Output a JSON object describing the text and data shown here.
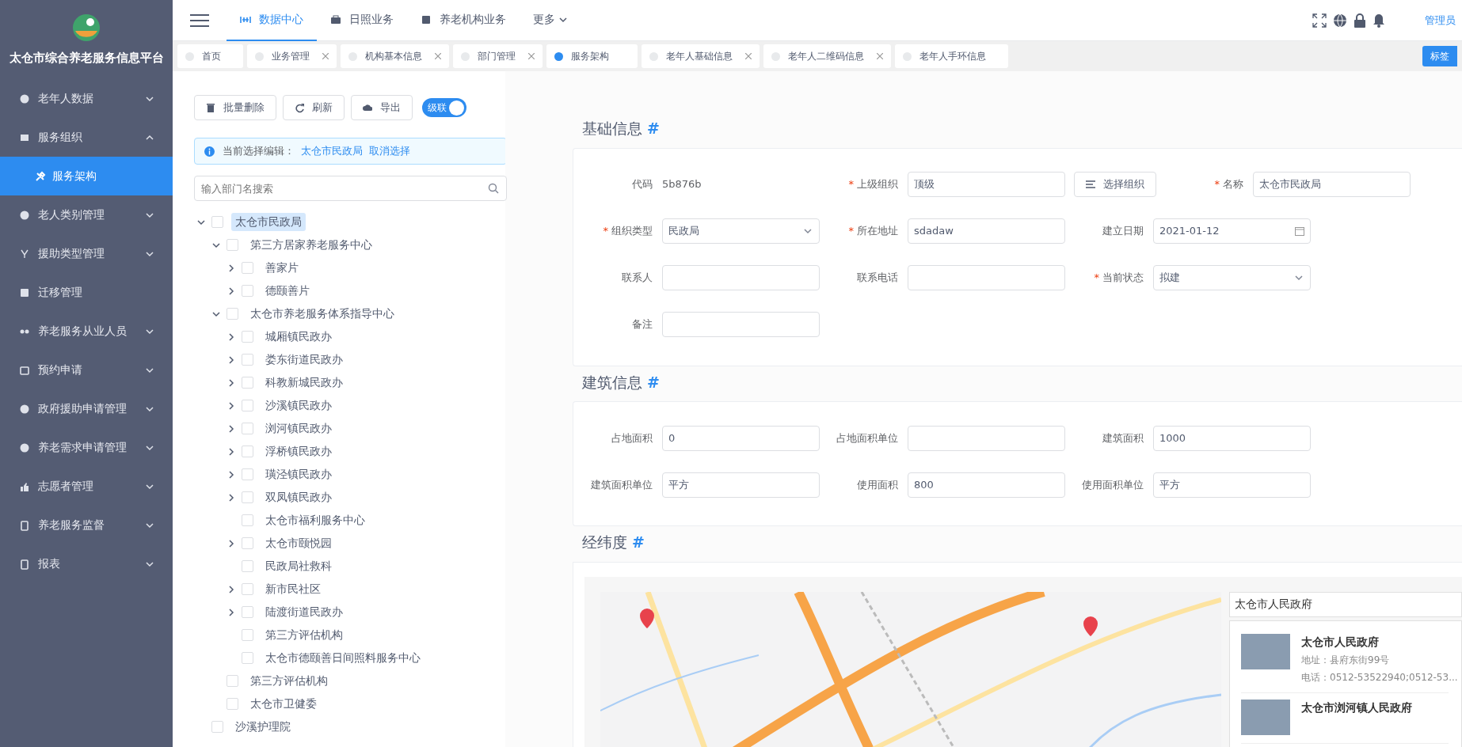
{
  "app": {
    "title": "太仓市综合养老服务信息平台"
  },
  "sidebar": {
    "items": [
      {
        "label": "老年人数据",
        "kind": "group",
        "expanded": false
      },
      {
        "label": "服务组织",
        "kind": "group",
        "expanded": true,
        "children": [
          {
            "label": "服务架构",
            "selected": true
          }
        ]
      },
      {
        "label": "老人类别管理",
        "kind": "group",
        "expanded": false
      },
      {
        "label": "援助类型管理",
        "kind": "group",
        "expanded": false
      },
      {
        "label": "迁移管理",
        "kind": "link"
      },
      {
        "label": "养老服务从业人员",
        "kind": "group",
        "expanded": false
      },
      {
        "label": "预约申请",
        "kind": "group",
        "expanded": false
      },
      {
        "label": "政府援助申请管理",
        "kind": "group",
        "expanded": false
      },
      {
        "label": "养老需求申请管理",
        "kind": "group",
        "expanded": false
      },
      {
        "label": "志愿者管理",
        "kind": "group",
        "expanded": false
      },
      {
        "label": "养老服务监督",
        "kind": "group",
        "expanded": false
      },
      {
        "label": "报表",
        "kind": "group",
        "expanded": false
      }
    ]
  },
  "topnav": {
    "items": [
      {
        "label": "数据中心",
        "selected": true
      },
      {
        "label": "日照业务",
        "selected": false
      },
      {
        "label": "养老机构业务",
        "selected": false
      },
      {
        "label": "更多",
        "selected": false,
        "dropdown": true
      }
    ],
    "user": "管理员"
  },
  "tabs": {
    "items": [
      {
        "label": "首页",
        "selected": false,
        "closable": false
      },
      {
        "label": "业务管理",
        "selected": false,
        "closable": true
      },
      {
        "label": "机构基本信息",
        "selected": false,
        "closable": true
      },
      {
        "label": "部门管理",
        "selected": false,
        "closable": true
      },
      {
        "label": "服务架构",
        "selected": true,
        "closable": false
      },
      {
        "label": "老年人基础信息",
        "selected": false,
        "closable": true
      },
      {
        "label": "老年人二维码信息",
        "selected": false,
        "closable": true
      },
      {
        "label": "老年人手环信息",
        "selected": false,
        "closable": false
      }
    ],
    "menu_button": "标签"
  },
  "toolbar": {
    "buttons": [
      {
        "label": "批量删除",
        "kind": "delete"
      },
      {
        "label": "刷新",
        "kind": "refresh"
      },
      {
        "label": "导出",
        "kind": "export"
      }
    ],
    "cascade": {
      "label": "级联",
      "on": true
    }
  },
  "selection_alert": {
    "prefix": "当前选择编辑：",
    "current": "太仓市民政局",
    "cancel": "取消选择"
  },
  "tree_search": {
    "placeholder": "输入部门名搜索"
  },
  "tree": [
    {
      "label": "太仓市民政局",
      "kind": "branch",
      "expanded": true,
      "checked": false,
      "selected": true,
      "children": [
        {
          "label": "第三方居家养老服务中心",
          "kind": "branch",
          "expanded": true,
          "checked": false,
          "selected": false,
          "children": [
            {
              "label": "善家片",
              "kind": "branch",
              "expanded": false,
              "checked": false,
              "selected": false
            },
            {
              "label": "德颐善片",
              "kind": "branch",
              "expanded": false,
              "checked": false,
              "selected": false
            }
          ]
        },
        {
          "label": "太仓市养老服务体系指导中心",
          "kind": "branch",
          "expanded": true,
          "checked": false,
          "selected": false,
          "children": [
            {
              "label": "城厢镇民政办",
              "kind": "branch",
              "expanded": false,
              "checked": false,
              "selected": false
            },
            {
              "label": "娄东街道民政办",
              "kind": "branch",
              "expanded": false,
              "checked": false,
              "selected": false
            },
            {
              "label": "科教新城民政办",
              "kind": "branch",
              "expanded": false,
              "checked": false,
              "selected": false
            },
            {
              "label": "沙溪镇民政办",
              "kind": "branch",
              "expanded": false,
              "checked": false,
              "selected": false
            },
            {
              "label": "浏河镇民政办",
              "kind": "branch",
              "expanded": false,
              "checked": false,
              "selected": false
            },
            {
              "label": "浮桥镇民政办",
              "kind": "branch",
              "expanded": false,
              "checked": false,
              "selected": false
            },
            {
              "label": "璜泾镇民政办",
              "kind": "branch",
              "expanded": false,
              "checked": false,
              "selected": false
            },
            {
              "label": "双凤镇民政办",
              "kind": "branch",
              "expanded": false,
              "checked": false,
              "selected": false
            },
            {
              "label": "太仓市福利服务中心",
              "kind": "leaf",
              "checked": false,
              "selected": false
            },
            {
              "label": "太仓市颐悦园",
              "kind": "branch",
              "expanded": false,
              "checked": false,
              "selected": false
            },
            {
              "label": "民政局社救科",
              "kind": "leaf",
              "checked": false,
              "selected": false
            },
            {
              "label": "新市民社区",
              "kind": "branch",
              "expanded": false,
              "checked": false,
              "selected": false
            },
            {
              "label": "陆渡街道民政办",
              "kind": "branch",
              "expanded": false,
              "checked": false,
              "selected": false
            },
            {
              "label": "第三方评估机构",
              "kind": "leaf",
              "checked": false,
              "selected": false
            },
            {
              "label": "太仓市德颐善日间照料服务中心",
              "kind": "leaf",
              "checked": false,
              "selected": false
            }
          ]
        },
        {
          "label": "第三方评估机构",
          "kind": "leaf",
          "checked": false,
          "selected": false
        },
        {
          "label": "太仓市卫健委",
          "kind": "leaf",
          "checked": false,
          "selected": false
        }
      ]
    },
    {
      "label": "沙溪护理院",
      "kind": "leaf",
      "checked": false,
      "selected": false
    }
  ],
  "sections": [
    {
      "title": "基础信息",
      "anchor": "#",
      "rows": [
        [
          {
            "label": "代码",
            "kind": "static",
            "value": "5b876b"
          },
          {
            "label": "上级组织",
            "required_mark": "*",
            "kind": "text",
            "value": "顶级",
            "action": "选择组织"
          },
          {
            "label": "名称",
            "required_mark": "*",
            "kind": "text",
            "value": "太仓市民政局"
          }
        ],
        [
          {
            "label": "组织类型",
            "required_mark": "*",
            "kind": "select",
            "value": "民政局"
          },
          {
            "label": "所在地址",
            "required_mark": "*",
            "kind": "text",
            "value": "sdadaw"
          },
          {
            "label": "建立日期",
            "kind": "date",
            "value": "2021-01-12"
          }
        ],
        [
          {
            "label": "联系人",
            "kind": "text"
          },
          {
            "label": "联系电话",
            "kind": "text"
          },
          {
            "label": "当前状态",
            "required_mark": "*",
            "kind": "select",
            "value": "拟建"
          }
        ],
        [
          {
            "label": "备注",
            "kind": "text"
          }
        ]
      ]
    },
    {
      "title": "建筑信息",
      "anchor": "#",
      "rows": [
        [
          {
            "label": "占地面积",
            "kind": "text",
            "value": "0"
          },
          {
            "label": "占地面积单位",
            "kind": "text"
          },
          {
            "label": "建筑面积",
            "kind": "text",
            "value": "1000"
          }
        ],
        [
          {
            "label": "建筑面积单位",
            "kind": "text",
            "value": "平方"
          },
          {
            "label": "使用面积",
            "kind": "text",
            "value": "800"
          },
          {
            "label": "使用面积单位",
            "kind": "text",
            "value": "平方"
          }
        ]
      ]
    }
  ],
  "map_section": {
    "title": "经纬度",
    "anchor": "#",
    "search": {
      "value": "太仓市人民政府"
    },
    "results": [
      {
        "name": "太仓市人民政府",
        "address": "地址：县府东街99号",
        "phone": "电话：0512-53522940;0512-53..."
      },
      {
        "name": "太仓市浏河镇人民政府"
      }
    ]
  }
}
